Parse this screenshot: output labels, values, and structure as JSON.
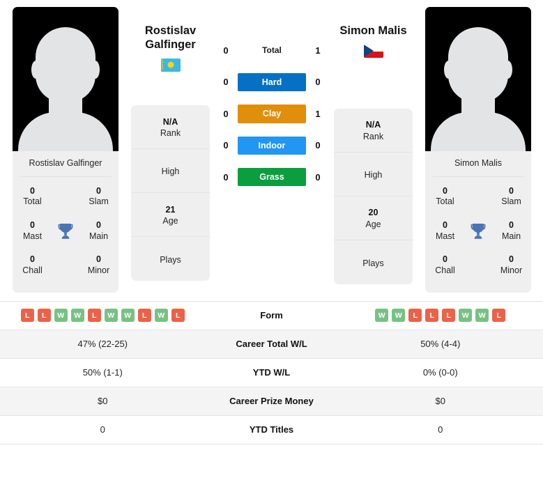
{
  "players": {
    "left": {
      "first_name": "Rostislav",
      "last_name": "Galfinger",
      "full_name": "Rostislav Galfinger",
      "flag": "kazakhstan-flag",
      "avatar": "player-photo-placeholder",
      "titles": {
        "total_value": "0",
        "total_label": "Total",
        "slam_value": "0",
        "slam_label": "Slam",
        "mast_value": "0",
        "mast_label": "Mast",
        "main_value": "0",
        "main_label": "Main",
        "chall_value": "0",
        "chall_label": "Chall",
        "minor_value": "0",
        "minor_label": "Minor"
      },
      "info": {
        "rank_value": "N/A",
        "rank_label": "Rank",
        "high_value": "",
        "high_label": "High",
        "age_value": "21",
        "age_label": "Age",
        "plays_value": "",
        "plays_label": "Plays"
      },
      "form": [
        "L",
        "L",
        "W",
        "W",
        "L",
        "W",
        "W",
        "L",
        "W",
        "L"
      ],
      "career_total_wl": "47% (22-25)",
      "ytd_wl": "50% (1-1)",
      "career_prize_money": "$0",
      "ytd_titles": "0"
    },
    "right": {
      "first_name": "Simon",
      "last_name": "Malis",
      "full_name": "Simon Malis",
      "flag": "czech-republic-flag",
      "avatar": "player-photo-placeholder",
      "titles": {
        "total_value": "0",
        "total_label": "Total",
        "slam_value": "0",
        "slam_label": "Slam",
        "mast_value": "0",
        "mast_label": "Mast",
        "main_value": "0",
        "main_label": "Main",
        "chall_value": "0",
        "chall_label": "Chall",
        "minor_value": "0",
        "minor_label": "Minor"
      },
      "info": {
        "rank_value": "N/A",
        "rank_label": "Rank",
        "high_value": "",
        "high_label": "High",
        "age_value": "20",
        "age_label": "Age",
        "plays_value": "",
        "plays_label": "Plays"
      },
      "form": [
        "W",
        "W",
        "L",
        "L",
        "L",
        "W",
        "W",
        "L"
      ],
      "career_total_wl": "50% (4-4)",
      "ytd_wl": "0% (0-0)",
      "career_prize_money": "$0",
      "ytd_titles": "0"
    }
  },
  "h2h": {
    "rows": [
      {
        "label": "Total",
        "left": "0",
        "right": "1",
        "color": ""
      },
      {
        "label": "Hard",
        "left": "0",
        "right": "0",
        "color": "#0571c4"
      },
      {
        "label": "Clay",
        "left": "0",
        "right": "1",
        "color": "#e08e0b"
      },
      {
        "label": "Indoor",
        "left": "0",
        "right": "0",
        "color": "#2196f3"
      },
      {
        "label": "Grass",
        "left": "0",
        "right": "0",
        "color": "#0a9e3f"
      }
    ]
  },
  "comparison_table": {
    "rows": [
      {
        "label": "Form"
      },
      {
        "label": "Career Total W/L"
      },
      {
        "label": "YTD W/L"
      },
      {
        "label": "Career Prize Money"
      },
      {
        "label": "YTD Titles"
      }
    ]
  },
  "colors": {
    "hard": "#0571c4",
    "clay": "#e08e0b",
    "indoor": "#2196f3",
    "grass": "#0a9e3f",
    "win_badge": "#77c282",
    "loss_badge": "#ec6249",
    "trophy": "#4a74b5",
    "card_bg": "#efefef"
  }
}
